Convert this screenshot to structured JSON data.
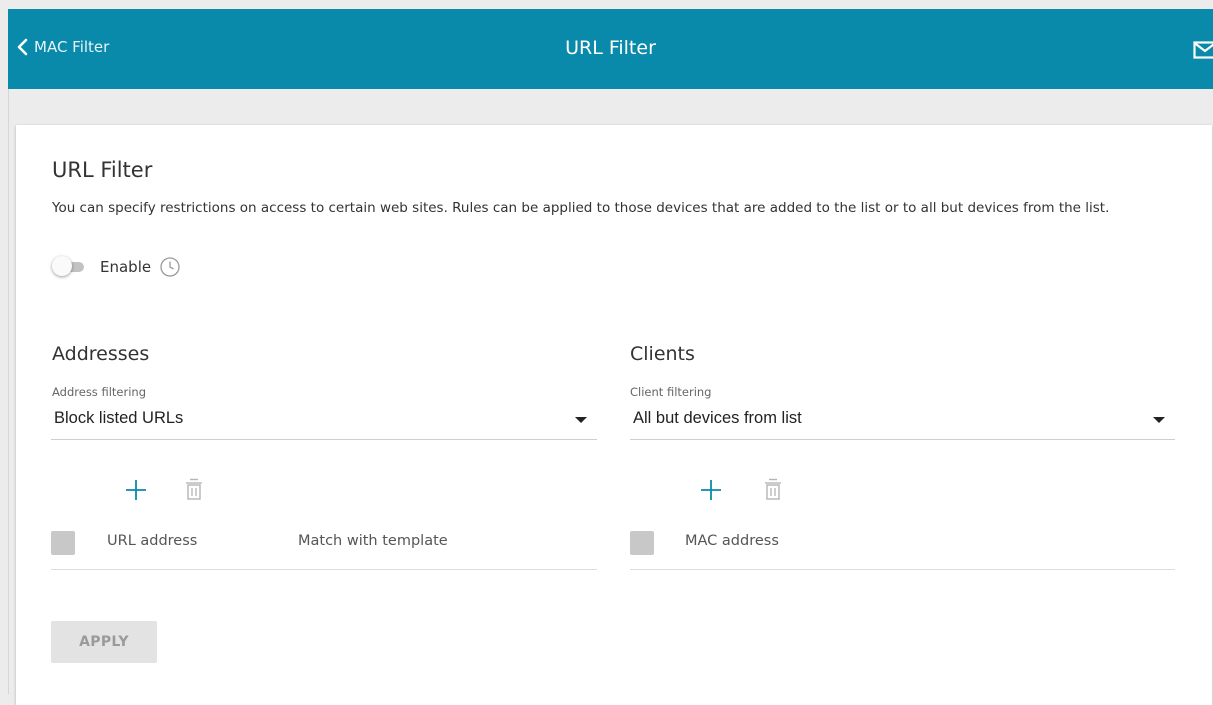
{
  "header": {
    "back_label": "MAC Filter",
    "title": "URL Filter",
    "accent_color": "#0a8aaa"
  },
  "card": {
    "title": "URL Filter",
    "description": "You can specify restrictions on access to certain web sites. Rules can be applied to those devices that are added to the list or to all but devices from the list.",
    "enable_label": "Enable",
    "enable_state": false
  },
  "addresses": {
    "title": "Addresses",
    "filter_label": "Address filtering",
    "filter_value": "Block listed URLs",
    "columns": [
      "URL address",
      "Match with template"
    ]
  },
  "clients": {
    "title": "Clients",
    "filter_label": "Client filtering",
    "filter_value": "All but devices from list",
    "columns": [
      "MAC address"
    ]
  },
  "actions": {
    "apply_label": "APPLY"
  },
  "icons": {
    "back": "chevron-left-icon",
    "mail": "mail-icon",
    "schedule": "clock-icon",
    "add": "plus-icon",
    "delete": "trash-icon"
  }
}
